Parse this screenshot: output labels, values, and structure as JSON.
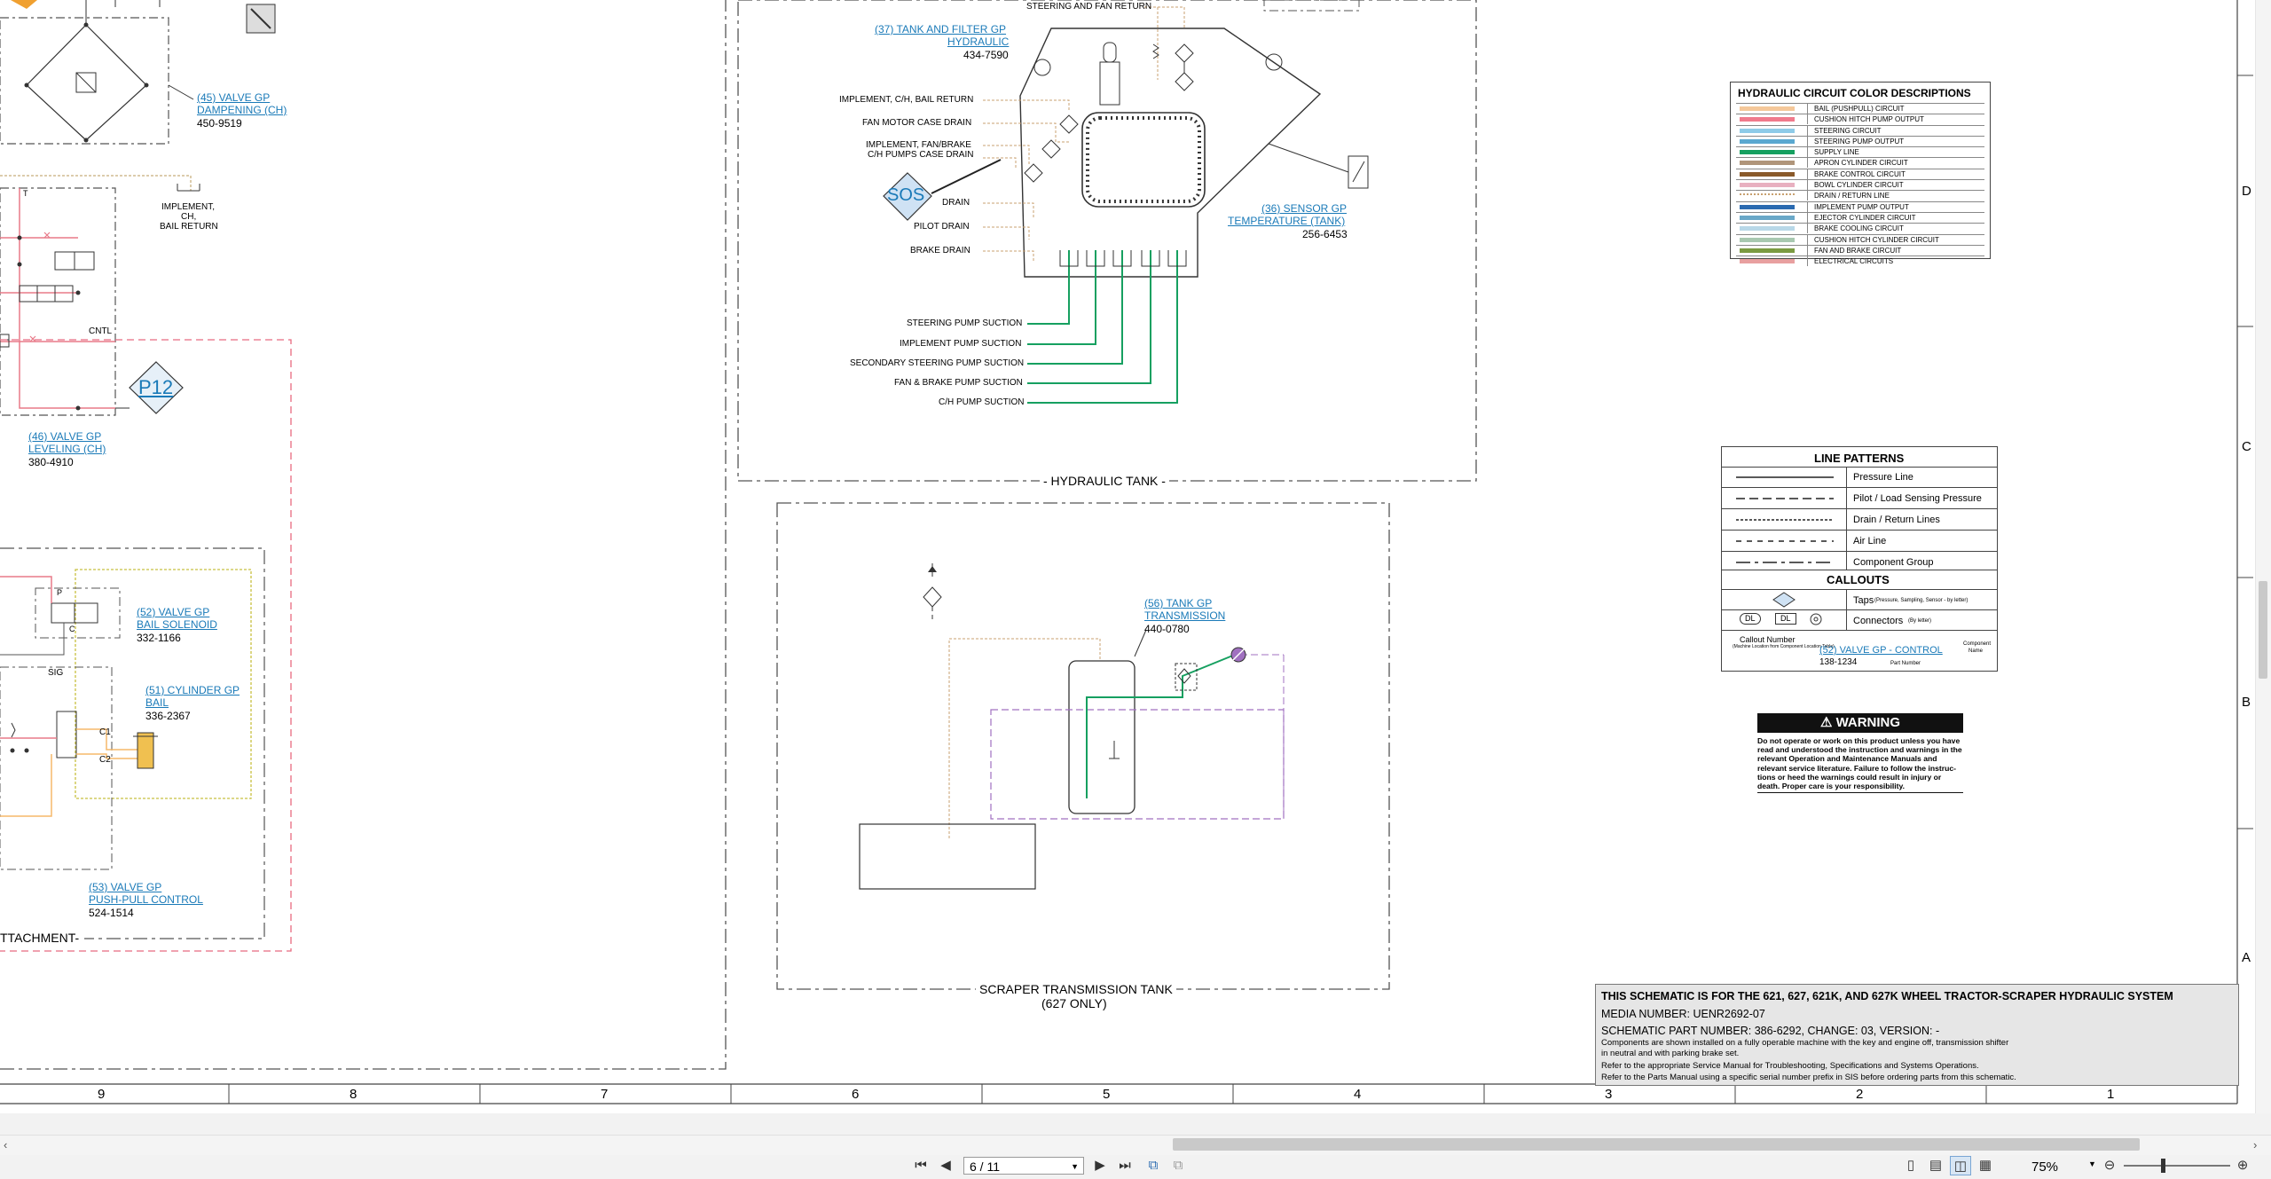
{
  "document": {
    "left_sheet": {
      "callouts": [
        {
          "name": "(45) VALVE GP",
          "name2": "DAMPENING (CH)",
          "part": "450-9519"
        },
        {
          "name": "(46) VALVE GP",
          "name2": "LEVELING (CH)",
          "part": "380-4910"
        },
        {
          "name": "(52) VALVE GP",
          "name2": "BAIL SOLENOID",
          "part": "332-1166"
        },
        {
          "name": "(51) CYLINDER GP",
          "name2": "BAIL",
          "part": "336-2367"
        },
        {
          "name": "(53) VALVE GP",
          "name2": "PUSH-PULL CONTROL",
          "part": "524-1514"
        }
      ],
      "labels": {
        "impl_return_1": "IMPLEMENT,",
        "impl_return_2": "CH,",
        "impl_return_3": "BAIL RETURN",
        "cntl": "CNTL",
        "p12": "P12",
        "sig": "SIG",
        "p": "P",
        "c": "C",
        "c1": "C1",
        "c2": "C2",
        "t": "T",
        "attachment": "TTACHMENT-"
      }
    },
    "hydraulic_tank": {
      "title": "- HYDRAULIC TANK -",
      "top_label": "STEERING AND FAN RETURN",
      "tank_callout": {
        "name": "(37) TANK AND FILTER GP",
        "name2": "HYDRAULIC",
        "part": "434-7590"
      },
      "sensor_callout": {
        "name": "(36) SENSOR GP",
        "name2": "TEMPERATURE (TANK)",
        "part": "256-6453"
      },
      "sos": "SOS",
      "inputs": [
        "IMPLEMENT, C/H, BAIL RETURN",
        "FAN MOTOR CASE DRAIN",
        "IMPLEMENT, FAN/BRAKE",
        "C/H PUMPS CASE DRAIN",
        "DRAIN",
        "PILOT DRAIN",
        "BRAKE DRAIN"
      ],
      "suctions": [
        "STEERING PUMP SUCTION",
        "IMPLEMENT PUMP SUCTION",
        "SECONDARY STEERING PUMP SUCTION",
        "FAN & BRAKE PUMP SUCTION",
        "C/H PUMP SUCTION"
      ]
    },
    "transmission_tank": {
      "title": "SCRAPER TRANSMISSION TANK",
      "subtitle": "(627 ONLY)",
      "callout": {
        "name": "(56) TANK GP",
        "name2": "TRANSMISSION",
        "part": "440-0780"
      }
    },
    "color_legend": {
      "title": "HYDRAULIC CIRCUIT COLOR DESCRIPTIONS",
      "rows": [
        {
          "color": "#f5c89a",
          "label": "BAIL (PUSHPULL) CIRCUIT",
          "dashed": false
        },
        {
          "color": "#f07a8c",
          "label": "CUSHION HITCH PUMP OUTPUT",
          "dashed": false
        },
        {
          "color": "#8ecbe8",
          "label": "STEERING CIRCUIT",
          "dashed": false
        },
        {
          "color": "#5aa8d0",
          "label": "STEERING PUMP OUTPUT",
          "dashed": false
        },
        {
          "color": "#16a060",
          "label": "SUPPLY LINE",
          "dashed": false
        },
        {
          "color": "#b0957a",
          "label": "APRON CYLINDER CIRCUIT",
          "dashed": false
        },
        {
          "color": "#8a5a2a",
          "label": "BRAKE CONTROL CIRCUIT",
          "dashed": false
        },
        {
          "color": "#e8b0c0",
          "label": "BOWL CYLINDER CIRCUIT",
          "dashed": false
        },
        {
          "color": "#c8a070",
          "label": "DRAIN / RETURN LINE",
          "dashed": true
        },
        {
          "color": "#2a6ab0",
          "label": "IMPLEMENT PUMP OUTPUT",
          "dashed": false
        },
        {
          "color": "#6aa8c8",
          "label": "EJECTOR CYLINDER CIRCUIT",
          "dashed": false
        },
        {
          "color": "#b8d8e8",
          "label": "BRAKE COOLING CIRCUIT",
          "dashed": false
        },
        {
          "color": "#a8c8b0",
          "label": "CUSHION HITCH CYLINDER CIRCUIT",
          "dashed": false
        },
        {
          "color": "#7a9a40",
          "label": "FAN AND BRAKE CIRCUIT",
          "dashed": false
        },
        {
          "color": "#e8a0a0",
          "label": "ELECTRICAL CIRCUITS",
          "dashed": false
        }
      ]
    },
    "line_patterns": {
      "title": "LINE PATTERNS",
      "rows": [
        {
          "label": "Pressure Line",
          "dash": "none"
        },
        {
          "label": "Pilot / Load Sensing Pressure",
          "dash": "10,5"
        },
        {
          "label": "Drain / Return Lines",
          "dash": "3,2"
        },
        {
          "label": "Air Line",
          "dash": "6,6"
        },
        {
          "label": "Component Group",
          "dash": "16,5,4,5"
        }
      ],
      "callouts_title": "CALLOUTS",
      "taps_label": "Taps",
      "taps_note": "(Pressure, Sampling, Sensor - by letter)",
      "connectors_label": "Connectors",
      "connectors_note": "(By letter)",
      "connector_codes": [
        "DL",
        "DL"
      ],
      "example_callout_number": "Callout Number",
      "example_callout_note": "(Machine Location from Component Location Table)",
      "example_link": "(52) VALVE GP - CONTROL",
      "example_part": "138-1234",
      "example_part_label": "Part Number",
      "example_component": "Component",
      "example_component2": "Name"
    },
    "warning": {
      "head": "WARNING",
      "lines": [
        "Do not operate or work on this product unless you have",
        "read and understood the instruction and warnings in the",
        "relevant Operation and Maintenance Manuals and",
        "relevant service literature. Failure to follow the instruc-",
        "tions or heed the warnings could result in injury or",
        "death. Proper care is your responsibility."
      ]
    },
    "title_block": {
      "heading": "THIS SCHEMATIC IS FOR THE 621, 627, 621K, AND 627K WHEEL TRACTOR-SCRAPER HYDRAULIC SYSTEM",
      "media": "MEDIA NUMBER: UENR2692-07",
      "part": "SCHEMATIC PART NUMBER: 386-6292, CHANGE: 03, VERSION: -",
      "notes": [
        "Components are shown installed on a fully operable machine with the key and engine off, transmission shifter",
        "in neutral and with parking brake set.",
        "Refer to the appropriate Service Manual for Troubleshooting, Specifications and Systems Operations.",
        "Refer to the Parts Manual using a specific serial number prefix in SIS before ordering parts from this schematic."
      ]
    },
    "zone_columns": [
      "9",
      "8",
      "7",
      "6",
      "5",
      "4",
      "3",
      "2",
      "1"
    ],
    "zone_rows": [
      "D",
      "C",
      "B",
      "A"
    ]
  },
  "toolbar": {
    "page_display": "6 / 11",
    "zoom": "75%",
    "first_icon": "first-page-icon",
    "prev_icon": "prev-page-icon",
    "next_icon": "next-page-icon",
    "last_icon": "last-page-icon"
  }
}
